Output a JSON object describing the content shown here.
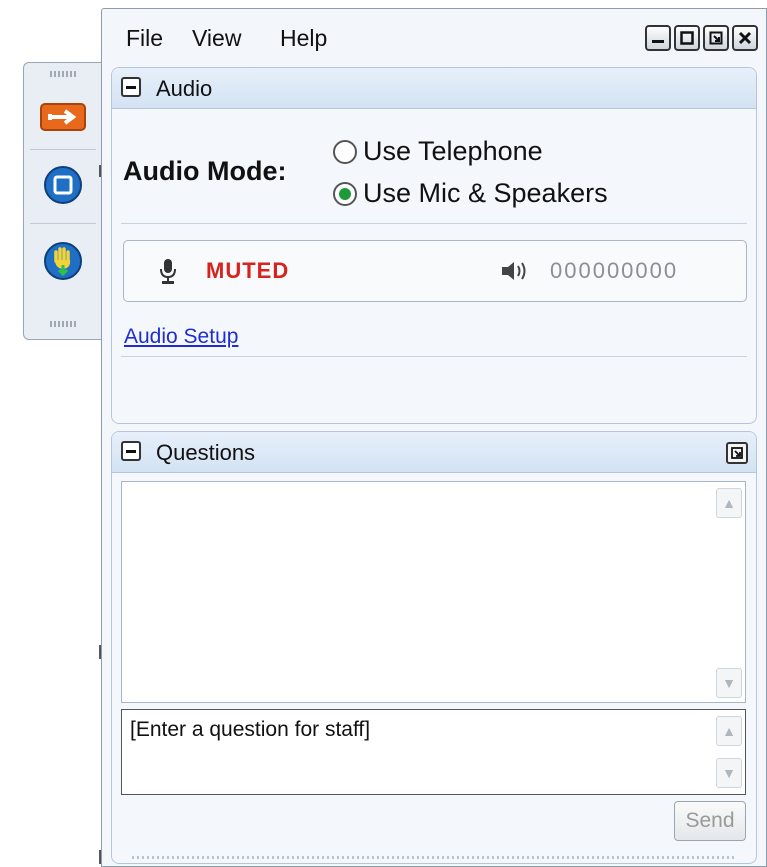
{
  "menu": {
    "file": "File",
    "view": "View",
    "help": "Help"
  },
  "window_buttons": [
    "minimize-icon",
    "restore-icon",
    "popout-icon",
    "close-icon"
  ],
  "sidebar": {
    "buttons": [
      {
        "icon": "arrow-right-icon"
      },
      {
        "icon": "stop-icon"
      },
      {
        "icon": "raise-hand-icon"
      }
    ]
  },
  "audio": {
    "title": "Audio",
    "mode_label": "Audio Mode:",
    "options": [
      {
        "label": "Use Telephone",
        "selected": false
      },
      {
        "label": "Use Mic & Speakers",
        "selected": true
      }
    ],
    "mic_status": "MUTED",
    "speaker_level": "000000000",
    "setup_link": "Audio Setup"
  },
  "questions": {
    "title": "Questions",
    "input_placeholder": "[Enter a question for staff]",
    "send_label": "Send"
  },
  "colors": {
    "muted_red": "#d6231f",
    "radio_selected": "#1d9a3a",
    "link_blue": "#1f2ccf",
    "panel_header": "#d3e2f3"
  }
}
